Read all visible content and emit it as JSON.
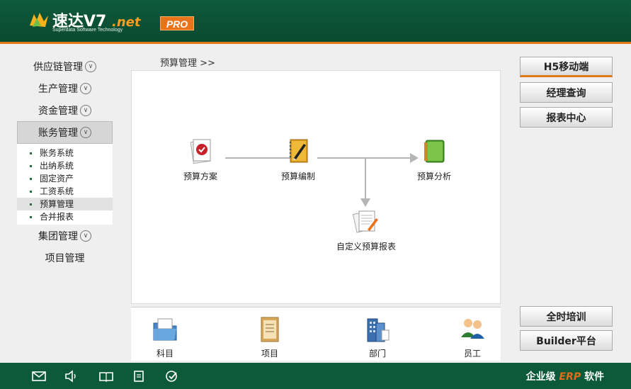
{
  "header": {
    "logo_name": "速达V7",
    "logo_net": ".net",
    "logo_sub": "Superdata Software Technology",
    "pro": "PRO"
  },
  "sidebar": {
    "items": [
      {
        "label": "供应链管理"
      },
      {
        "label": "生产管理"
      },
      {
        "label": "资金管理"
      },
      {
        "label": "账务管理"
      }
    ],
    "sub_items": [
      "账务系统",
      "出纳系统",
      "固定资产",
      "工资系统",
      "预算管理",
      "合并报表"
    ],
    "after_items": [
      {
        "label": "集团管理"
      },
      {
        "label": "项目管理"
      }
    ]
  },
  "breadcrumb": "预算管理  >>",
  "flow": {
    "plan": "预算方案",
    "compile": "预算编制",
    "analysis": "预算分析",
    "custom_report": "自定义预算报表"
  },
  "tray": {
    "subject": "科目",
    "project": "项目",
    "department": "部门",
    "employee": "员工"
  },
  "right_buttons": {
    "h5": "H5移动端",
    "manager": "经理查询",
    "reports": "报表中心",
    "training": "全时培训",
    "builder": "Builder平台"
  },
  "footer": {
    "prefix": "企业级",
    "erp": "ERP",
    "suffix": "软件"
  },
  "colors": {
    "header_green": "#0e5a3c",
    "accent_orange": "#e07a18"
  }
}
